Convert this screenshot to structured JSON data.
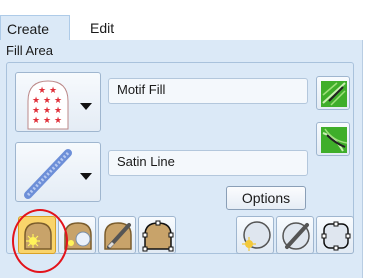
{
  "tabs": [
    {
      "label": "Create",
      "active": true
    },
    {
      "label": "Edit",
      "active": false
    }
  ],
  "group": {
    "label": "Fill Area"
  },
  "motif_fill": {
    "label": "Motif Fill",
    "icon": "motif-fill-pattern-icon"
  },
  "satin_line": {
    "label": "Satin Line",
    "icon": "satin-line-icon"
  },
  "options_button": {
    "label": "Options"
  },
  "side_icons": [
    "fill-direction-icon",
    "fill-direction-curve-icon"
  ],
  "tools": [
    {
      "icon": "closed-shape-sun-icon",
      "selected": true
    },
    {
      "icon": "shape-hole-icon",
      "selected": false
    },
    {
      "icon": "shape-pen-icon",
      "selected": false
    },
    {
      "icon": "shape-points-icon",
      "selected": false
    },
    {
      "icon": "circle-sun-icon",
      "selected": false
    },
    {
      "icon": "circle-pen-icon",
      "selected": false
    },
    {
      "icon": "rounded-square-points-icon",
      "selected": false
    }
  ],
  "colors": {
    "panel": "#dbe9f7",
    "highlight": "#e3131b",
    "selected_tool": "#f9d46b",
    "green": "#3fae2a"
  }
}
